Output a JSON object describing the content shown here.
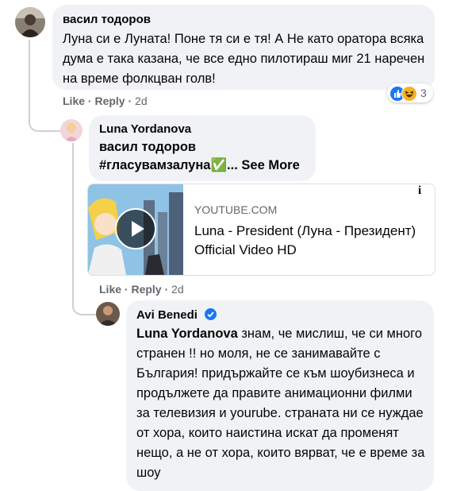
{
  "comment1": {
    "author": "васил тодоров",
    "text": "Луна си е Луната! Поне тя си е тя! А Не като оратора всяка дума е така казана, че все едно пилотираш миг 21 наречен на време фолкцван голв!",
    "like_label": "Like",
    "reply_label": "Reply",
    "separator": "·",
    "time": "2d",
    "reaction_count": "3",
    "reaction_icons": [
      "like-icon",
      "laugh-icon"
    ]
  },
  "comment2": {
    "author": "Luna Yordanova",
    "mention": "васил тодоров",
    "hashtag": "#гласувамзалуна",
    "emoji": "✅",
    "ellipsis": "...",
    "see_more": "See More",
    "like_label": "Like",
    "reply_label": "Reply",
    "separator": "·",
    "time": "2d",
    "link": {
      "domain": "YOUTUBE.COM",
      "title": "Luna - President (Луна - Президент) Official Video HD",
      "info_icon": "info-icon",
      "play_icon": "play-icon"
    }
  },
  "comment3": {
    "author": "Avi Benedi",
    "verified_icon": "verified-badge-icon",
    "mention": "Luna Yordanova",
    "text": " знам, че мислиш, че си много странен !! но моля, не се занимавайте с България! придържайте се към шоубизнеса и продължете да правите анимационни филми за телевизия и yourube. страната ни се нуждае от хора, които наистина искат да променят нещо, а не от хора, които вярват, че е време за шоу"
  },
  "colors": {
    "bubble": "#f0f2f5",
    "meta": "#65676b",
    "like_blue": "#1877f2",
    "laugh_yellow": "#f7b125",
    "thread": "#ccd0d5"
  }
}
